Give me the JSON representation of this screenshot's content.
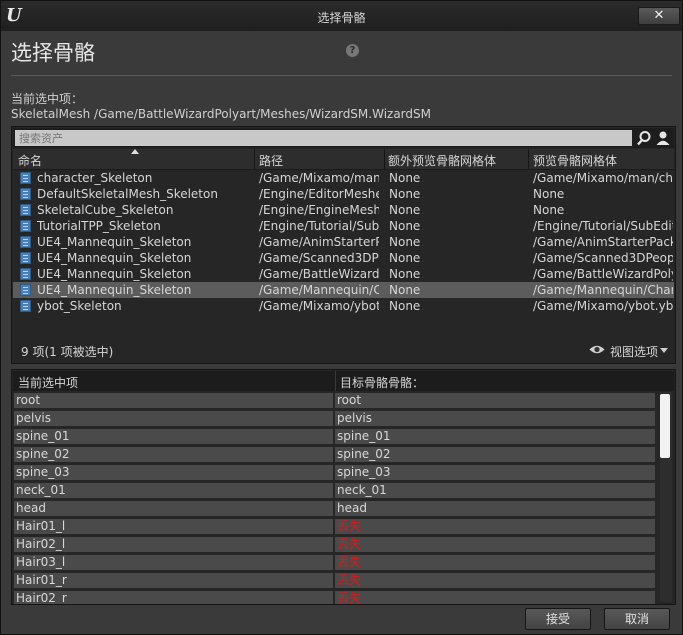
{
  "window": {
    "title": "选择骨骼",
    "close_label": "✕"
  },
  "header": {
    "title": "选择骨骼",
    "help": "?"
  },
  "current": {
    "label": "当前选中项：",
    "path": "SkeletalMesh /Game/BattleWizardPolyart/Meshes/WizardSM.WizardSM"
  },
  "picker": {
    "search_placeholder": "搜索资产",
    "columns": [
      "命名",
      "路径",
      "额外预览骨骼网格体",
      "预览骨骼网格体"
    ],
    "rows": [
      {
        "name": "character_Skeleton",
        "path": "/Game/Mixamo/man/",
        "extra": "None",
        "preview": "/Game/Mixamo/man/cha",
        "selected": false
      },
      {
        "name": "DefaultSkeletalMesh_Skeleton",
        "path": "/Engine/EditorMeshes",
        "extra": "None",
        "preview": "None",
        "selected": false
      },
      {
        "name": "SkeletalCube_Skeleton",
        "path": "/Engine/EngineMeshe",
        "extra": "None",
        "preview": "None",
        "selected": false
      },
      {
        "name": "TutorialTPP_Skeleton",
        "path": "/Engine/Tutorial/SubE",
        "extra": "None",
        "preview": "/Engine/Tutorial/SubEdit",
        "selected": false
      },
      {
        "name": "UE4_Mannequin_Skeleton",
        "path": "/Game/AnimStarterPa",
        "extra": "None",
        "preview": "/Game/AnimStarterPack/",
        "selected": false
      },
      {
        "name": "UE4_Mannequin_Skeleton",
        "path": "/Game/Scanned3DPe",
        "extra": "None",
        "preview": "/Game/Scanned3DPeople",
        "selected": false
      },
      {
        "name": "UE4_Mannequin_Skeleton",
        "path": "/Game/BattleWizardP",
        "extra": "None",
        "preview": "/Game/BattleWizardPoly",
        "selected": false
      },
      {
        "name": "UE4_Mannequin_Skeleton",
        "path": "/Game/Mannequin/Ch",
        "extra": "None",
        "preview": "/Game/Mannequin/Chara",
        "selected": true
      },
      {
        "name": "ybot_Skeleton",
        "path": "/Game/Mixamo/ybot_",
        "extra": "None",
        "preview": "/Game/Mixamo/ybot.ybo",
        "selected": false
      }
    ],
    "count_text": "9 项(1 项被选中)",
    "view_options_label": "视图选项"
  },
  "mapping": {
    "col_source": "当前选中项",
    "col_target": "目标骨骼骨骼：",
    "rows": [
      {
        "src": "root",
        "tgt": "root",
        "missing": false
      },
      {
        "src": "pelvis",
        "tgt": "pelvis",
        "missing": false
      },
      {
        "src": "spine_01",
        "tgt": "spine_01",
        "missing": false
      },
      {
        "src": "spine_02",
        "tgt": "spine_02",
        "missing": false
      },
      {
        "src": "spine_03",
        "tgt": "spine_03",
        "missing": false
      },
      {
        "src": "neck_01",
        "tgt": "neck_01",
        "missing": false
      },
      {
        "src": "head",
        "tgt": "head",
        "missing": false
      },
      {
        "src": "Hair01_l",
        "tgt": "丢失",
        "missing": true
      },
      {
        "src": "Hair02_l",
        "tgt": "丢失",
        "missing": true
      },
      {
        "src": "Hair03_l",
        "tgt": "丢失",
        "missing": true
      },
      {
        "src": "Hair01_r",
        "tgt": "丢失",
        "missing": true
      },
      {
        "src": "Hair02_r",
        "tgt": "丢失",
        "missing": true
      }
    ]
  },
  "footer": {
    "accept_label": "接受",
    "cancel_label": "取消"
  },
  "colors": {
    "missing": "#cc1f1f",
    "selected_row": "#5c5c5c",
    "scroll_thumb": "#f2f2f2"
  }
}
